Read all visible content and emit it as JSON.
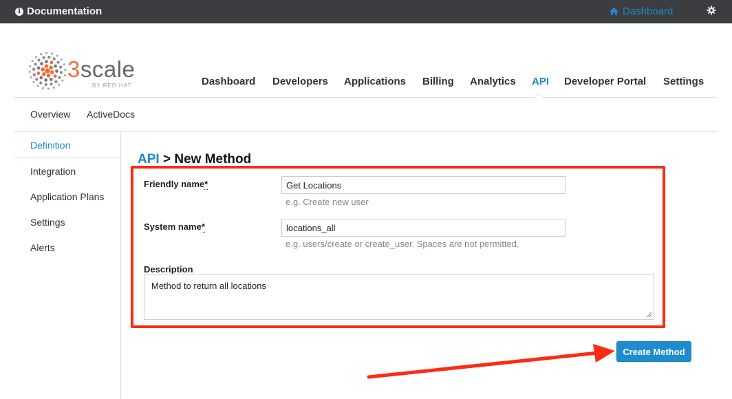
{
  "topbar": {
    "documentation_label": "Documentation",
    "dashboard_label": "Dashboard"
  },
  "logo": {
    "brand_prefix": "3",
    "brand_rest": "scale",
    "byline": "BY RED HAT"
  },
  "main_nav": {
    "items": [
      "Dashboard",
      "Developers",
      "Applications",
      "Billing",
      "Analytics",
      "API",
      "Developer Portal",
      "Settings"
    ],
    "active": "API"
  },
  "sub_nav": {
    "items": [
      "Overview",
      "ActiveDocs"
    ]
  },
  "sidebar": {
    "items": [
      "Definition",
      "Integration",
      "Application Plans",
      "Settings",
      "Alerts"
    ],
    "active": "Definition"
  },
  "page": {
    "breadcrumb": "API",
    "separator": ">",
    "title": "New Method"
  },
  "form": {
    "friendly_name": {
      "label": "Friendly name",
      "required_mark": "*",
      "value": "Get Locations",
      "hint": "e.g. Create new user"
    },
    "system_name": {
      "label": "System name",
      "required_mark": "*",
      "value": "locations_all",
      "hint": "e.g. users/create or create_user. Spaces are not permitted."
    },
    "description": {
      "label": "Description",
      "value": "Method to return all locations"
    },
    "submit_label": "Create Method"
  },
  "colors": {
    "accent": "#1e88c9",
    "annotation": "#ff2a12",
    "topbar": "#3b3d40"
  }
}
